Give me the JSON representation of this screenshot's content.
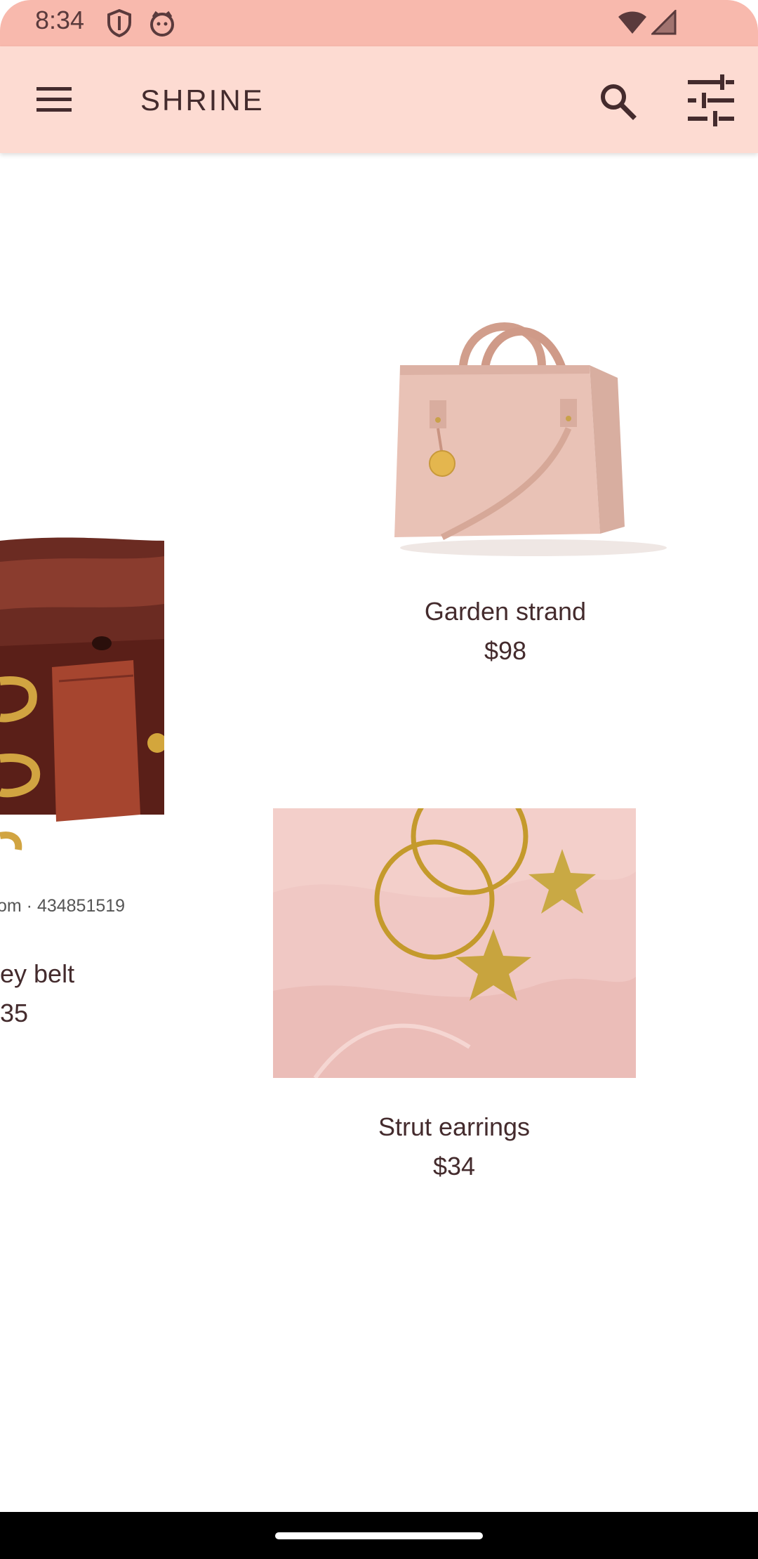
{
  "status_bar": {
    "time": "8:34",
    "icons": [
      "shield-icon",
      "face-icon",
      "wifi-icon",
      "signal-icon"
    ]
  },
  "app_bar": {
    "title": "SHRINE",
    "icons": [
      "menu-icon",
      "search-icon",
      "tune-icon"
    ]
  },
  "products": [
    {
      "name": "Garden strand",
      "price": "$98",
      "image": "handbag"
    },
    {
      "name": "ey belt",
      "price": "35",
      "image": "belt",
      "image_caption": "om · 434851519"
    },
    {
      "name": "Strut earrings",
      "price": "$34",
      "image": "star-earrings"
    }
  ],
  "colors": {
    "status_bar": "#f8b9ad",
    "app_bar": "#fddbd2",
    "text": "#442b2d",
    "nav_bar": "#000000"
  }
}
